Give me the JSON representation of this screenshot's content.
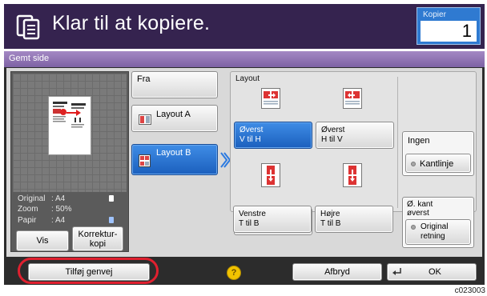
{
  "status": {
    "title": "Klar til at kopiere.",
    "copies_label": "Kopier",
    "copies_value": "1"
  },
  "tab": {
    "label": "Gemt side"
  },
  "preview": {
    "info": [
      {
        "key": "Original",
        "value": ": A4"
      },
      {
        "key": "Zoom",
        "value": ": 50%"
      },
      {
        "key": "Papir",
        "value": ": A4"
      }
    ],
    "buttons": {
      "view": "Vis",
      "proof_line1": "Korrektur-",
      "proof_line2": "kopi"
    }
  },
  "choices": {
    "from": "Fra",
    "layout_a": "Layout A",
    "layout_b": "Layout B"
  },
  "layout": {
    "title": "Layout",
    "options": [
      {
        "line1": "Øverst",
        "line2": "V til H"
      },
      {
        "line1": "Øverst",
        "line2": "H til V"
      },
      {
        "line1": "Venstre",
        "line2": "T til B"
      },
      {
        "line1": "Højre",
        "line2": "T til B"
      }
    ],
    "border": {
      "value": "Ingen",
      "label": "Kantlinje"
    },
    "orientation": {
      "line1": "Ø. kant",
      "line2": "øverst",
      "label_line1": "Original",
      "label_line2": "retning"
    }
  },
  "bottom": {
    "add_shortcut": "Tilføj genvej",
    "cancel": "Afbryd",
    "ok": "OK",
    "help": "?"
  },
  "image_code": "c023003",
  "colors": {
    "header": "#35234f",
    "selected": "#1b5fbd",
    "tab": "#8a6eb0",
    "highlight": "#e0202f"
  }
}
